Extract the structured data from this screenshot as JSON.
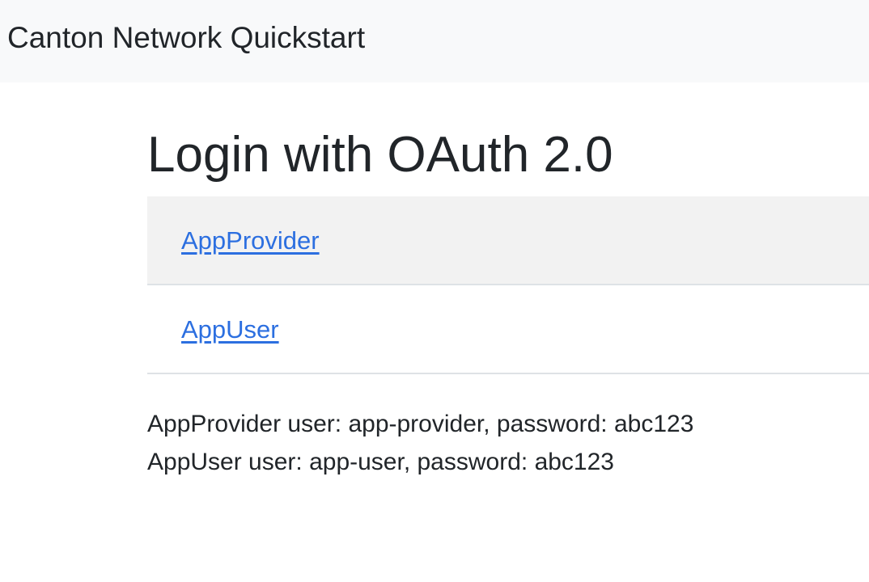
{
  "navbar": {
    "brand": "Canton Network Quickstart"
  },
  "main": {
    "title": "Login with OAuth 2.0",
    "login_options": [
      {
        "label": "AppProvider"
      },
      {
        "label": "AppUser"
      }
    ],
    "credentials": [
      "AppProvider user: app-provider, password: abc123",
      "AppUser user: app-user, password: abc123"
    ]
  },
  "colors": {
    "navbar_bg": "#f8f9fa",
    "link": "#2c6fe0",
    "text": "#212529",
    "row_highlight": "#f2f2f2"
  }
}
